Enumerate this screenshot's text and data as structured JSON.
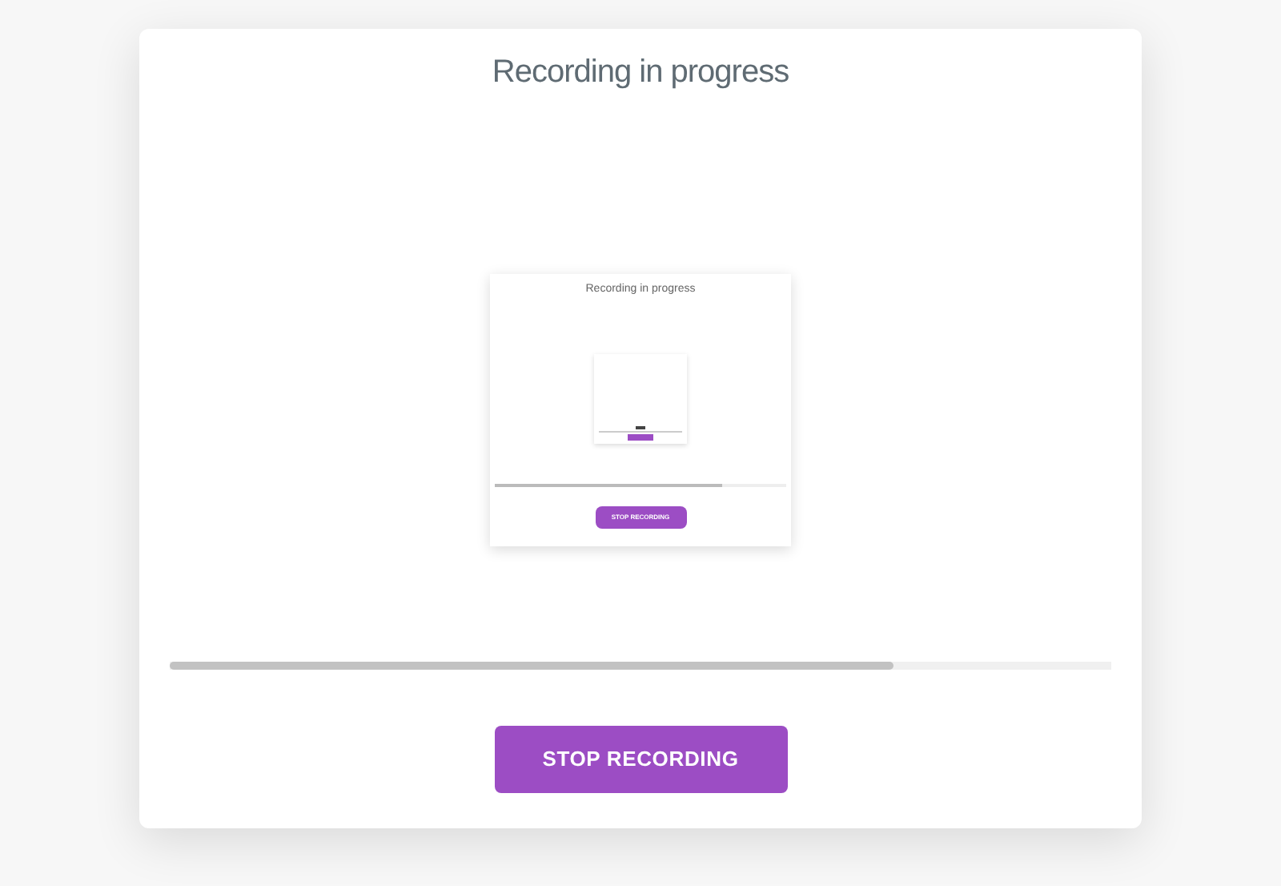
{
  "title": "Recording in progress",
  "preview": {
    "title": "Recording in progress",
    "progress": {
      "level": 0.78
    },
    "button": "STOP RECORDING"
  },
  "button": "STOP RECORDING"
}
